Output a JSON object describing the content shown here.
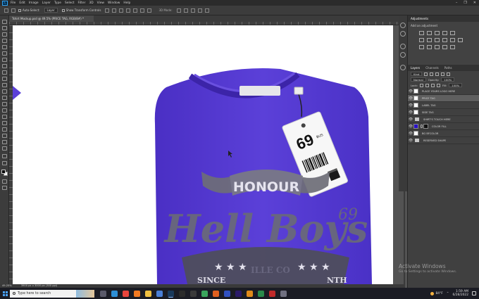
{
  "menubar": {
    "app_icon": "Ps",
    "items": [
      "File",
      "Edit",
      "Image",
      "Layer",
      "Type",
      "Select",
      "Filter",
      "3D",
      "View",
      "Window",
      "Help"
    ],
    "window_controls": [
      "–",
      "❐",
      "✕"
    ]
  },
  "options_bar": {
    "auto_select_label": "Auto-Select:",
    "auto_select_value": "Layer",
    "show_transform_label": "Show Transform Controls",
    "mode_3d_label": "3D Mode:"
  },
  "document": {
    "tab_title": "Tshirt Mockup.psd @ 49.5% (PRICE TAG, RGB/8#) *"
  },
  "artwork": {
    "tag_price": "69",
    "tag_small": "$US",
    "banner_text": "HONOUR",
    "script_text": "Hell Boys",
    "script_number": "69",
    "stars": "★ ★ ★",
    "lower_text_a": "SINCE",
    "lower_text_b": "ILLE CO",
    "lower_text_c": "NTH",
    "shirt_color": "#5b40d8"
  },
  "status_bar": {
    "zoom": "49.25%",
    "dimensions": "3900 px x 3000 px (300 ppi)"
  },
  "adjustments_panel": {
    "tab": "Adjustments",
    "subtitle": "Add an adjustment"
  },
  "layers_panel": {
    "tabs": [
      "Layers",
      "Channels",
      "Paths"
    ],
    "filter_kind": "Kind",
    "blend_mode": "Normal",
    "opacity_label": "Opacity:",
    "opacity_value": "100%",
    "lock_label": "Lock:",
    "fill_label": "Fill:",
    "fill_value": "100%",
    "layers": [
      {
        "name": "PLACE YOURS LOGO HERE",
        "visible": true,
        "selected": false,
        "thumb": "w",
        "folder": false
      },
      {
        "name": "PRICE TAG",
        "visible": true,
        "selected": true,
        "thumb": "w",
        "folder": false
      },
      {
        "name": "LABEL TAG",
        "visible": true,
        "selected": false,
        "thumb": "w",
        "folder": false
      },
      {
        "name": "SIDE TAG",
        "visible": true,
        "selected": false,
        "thumb": "w",
        "folder": false
      },
      {
        "name": "SHIRT'S TOUCH HERE",
        "visible": true,
        "selected": false,
        "thumb": "",
        "folder": true
      },
      {
        "name": "COLOR FILL",
        "visible": true,
        "selected": false,
        "thumb": "purple",
        "folder": false
      },
      {
        "name": "BG BFCOLOR",
        "visible": true,
        "selected": false,
        "thumb": "w",
        "folder": false
      },
      {
        "name": "RESERVED SHAPE",
        "visible": true,
        "selected": false,
        "thumb": "",
        "folder": true
      }
    ]
  },
  "watermark": {
    "line1": "Activate Windows",
    "line2": "Go to Settings to activate Windows."
  },
  "taskbar": {
    "search_placeholder": "Type here to search",
    "weather": "84°F",
    "time": "1:59 AM",
    "date": "6/28/2022",
    "apps": [
      {
        "name": "task-view",
        "color": "#5a5a6a"
      },
      {
        "name": "edge",
        "color": "#2d8fd6"
      },
      {
        "name": "chrome",
        "color": "#e8453c"
      },
      {
        "name": "firefox",
        "color": "#f27a21"
      },
      {
        "name": "file-explorer",
        "color": "#f0c040"
      },
      {
        "name": "store",
        "color": "#4a7fd6"
      },
      {
        "name": "photoshop",
        "color": "#1a3a5c",
        "active": true
      },
      {
        "name": "media",
        "color": "#2b2b2b"
      },
      {
        "name": "obs",
        "color": "#3a3a3a"
      },
      {
        "name": "chrome-2",
        "color": "#3aa55c"
      },
      {
        "name": "app-orange",
        "color": "#e06020"
      },
      {
        "name": "app-blue",
        "color": "#3050c0"
      },
      {
        "name": "after-effects",
        "color": "#2a1a6a"
      },
      {
        "name": "illustrator",
        "color": "#e08a1a"
      },
      {
        "name": "app-green",
        "color": "#2a8a4a"
      },
      {
        "name": "app-red",
        "color": "#c02a2a"
      },
      {
        "name": "app-gray",
        "color": "#707080"
      }
    ]
  }
}
